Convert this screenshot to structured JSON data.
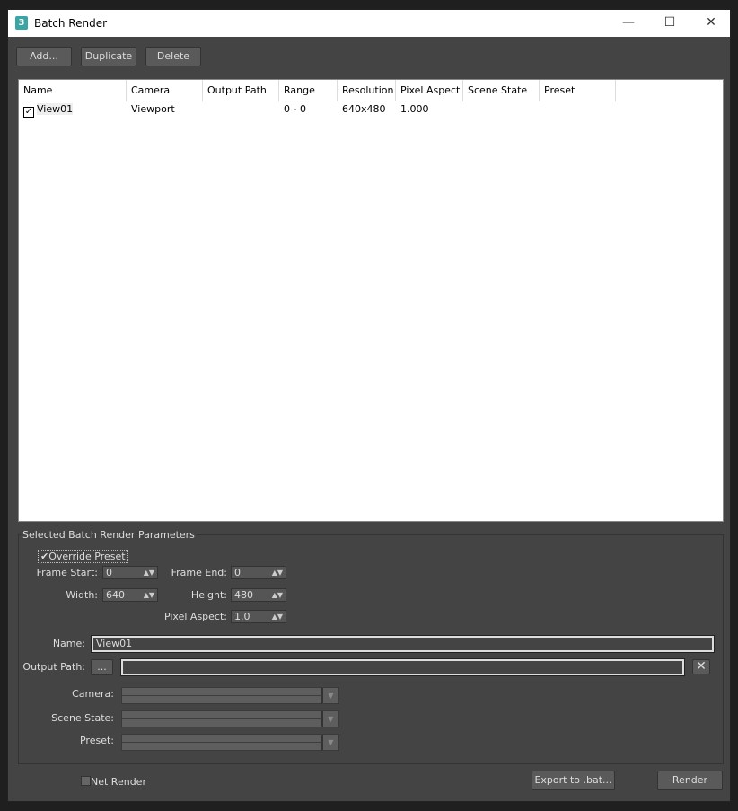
{
  "window": {
    "title": "Batch Render",
    "minimize": "—",
    "maximize": "☐",
    "close": "✕"
  },
  "toolbar": {
    "add": "Add...",
    "duplicate": "Duplicate",
    "delete": "Delete"
  },
  "list": {
    "columns": [
      "Name",
      "Camera",
      "Output Path",
      "Range",
      "Resolution",
      "Pixel Aspect",
      "Scene State",
      "Preset"
    ],
    "rows": [
      {
        "checked": true,
        "name": "View01",
        "camera": "Viewport",
        "output_path": "",
        "range": "0 - 0",
        "resolution": "640x480",
        "pixel_aspect": "1.000",
        "scene_state": "",
        "preset": ""
      }
    ]
  },
  "params": {
    "group_title": "Selected Batch Render Parameters",
    "override_preset": {
      "label": "Override Preset",
      "checked": true
    },
    "frame_start": {
      "label": "Frame Start:",
      "value": "0"
    },
    "frame_end": {
      "label": "Frame End:",
      "value": "0"
    },
    "width": {
      "label": "Width:",
      "value": "640"
    },
    "height": {
      "label": "Height:",
      "value": "480"
    },
    "pixel_aspect": {
      "label": "Pixel Aspect:",
      "value": "1.0"
    },
    "name": {
      "label": "Name:",
      "value": "View01"
    },
    "output_path": {
      "label": "Output Path:",
      "browse": "...",
      "value": ""
    },
    "camera": {
      "label": "Camera:"
    },
    "scene_state": {
      "label": "Scene State:"
    },
    "preset": {
      "label": "Preset:"
    }
  },
  "footer": {
    "net_render": "Net Render",
    "export": "Export to .bat...",
    "render": "Render"
  }
}
